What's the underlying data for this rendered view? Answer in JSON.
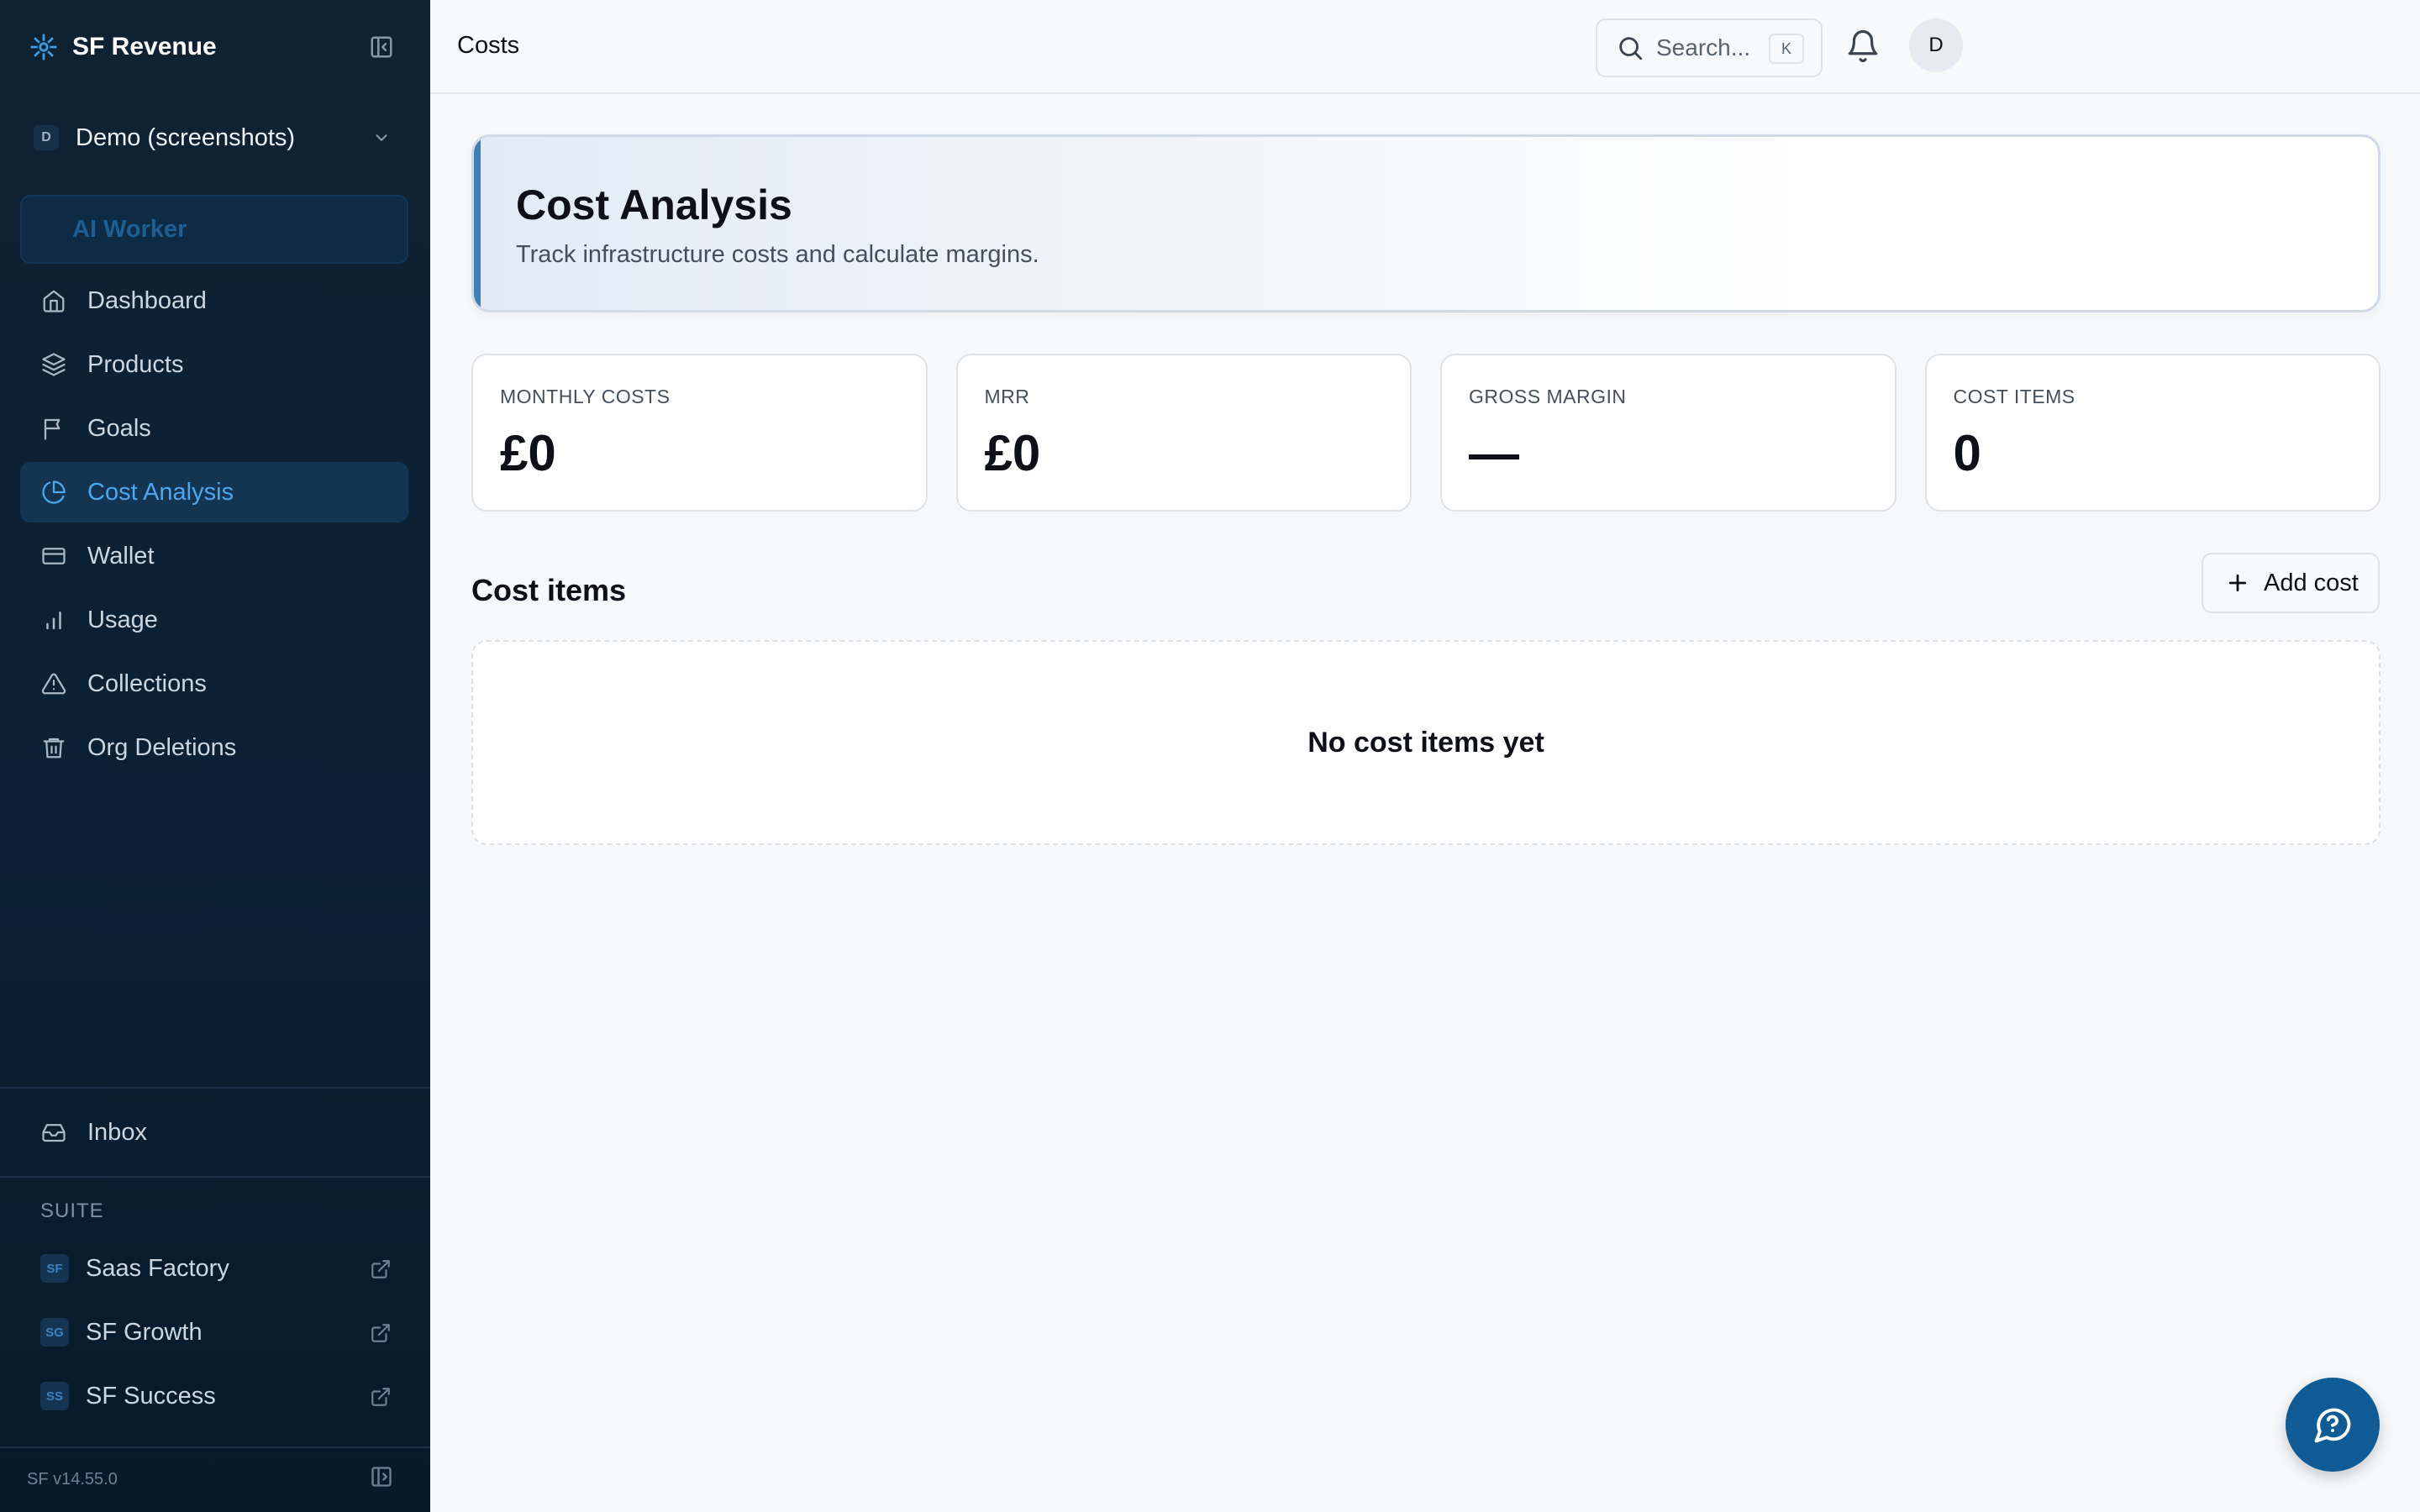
{
  "app": {
    "name": "SF Revenue",
    "icon": "sparkle-icon",
    "accent": "#4aa8ee"
  },
  "org": {
    "avatar": "D",
    "name": "Demo (screenshots)"
  },
  "ai_worker": {
    "label": "AI Worker"
  },
  "sidebar": {
    "items": [
      {
        "label": "Dashboard",
        "icon": "home-icon"
      },
      {
        "label": "Products",
        "icon": "layers-icon"
      },
      {
        "label": "Goals",
        "icon": "flag-icon"
      },
      {
        "label": "Cost Analysis",
        "icon": "pie-chart-icon",
        "active": true
      },
      {
        "label": "Wallet",
        "icon": "credit-card-icon"
      },
      {
        "label": "Usage",
        "icon": "bar-chart-icon"
      },
      {
        "label": "Collections",
        "icon": "warning-icon"
      },
      {
        "label": "Org Deletions",
        "icon": "trash-icon"
      }
    ],
    "inbox": {
      "label": "Inbox",
      "icon": "inbox-icon"
    },
    "suite_title": "SUITE",
    "suite": [
      {
        "badge": "SF",
        "label": "Saas Factory"
      },
      {
        "badge": "SG",
        "label": "SF Growth"
      },
      {
        "badge": "SS",
        "label": "SF Success"
      }
    ],
    "version": "SF v14.55.0"
  },
  "topbar": {
    "page": "Costs",
    "search_placeholder": "Search...",
    "search_shortcut": "K",
    "avatar": "D"
  },
  "hero": {
    "title": "Cost Analysis",
    "subtitle": "Track infrastructure costs and calculate margins."
  },
  "stats": [
    {
      "label": "MONTHLY COSTS",
      "value": "£0"
    },
    {
      "label": "MRR",
      "value": "£0"
    },
    {
      "label": "GROSS MARGIN",
      "value": "—"
    },
    {
      "label": "COST ITEMS",
      "value": "0"
    }
  ],
  "cost_items": {
    "title": "Cost items",
    "add_label": "Add cost",
    "empty_message": "No cost items yet"
  }
}
